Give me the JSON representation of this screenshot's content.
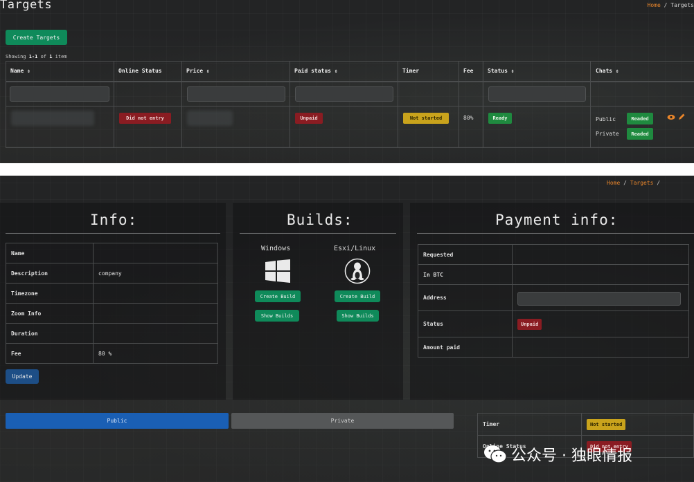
{
  "top": {
    "title": "Targets",
    "breadcrumb": {
      "home": "Home",
      "sep": "/",
      "current": "Targets"
    },
    "create_button": "Create Targets",
    "showing": {
      "prefix": "Showing ",
      "range": "1-1",
      "middle": " of ",
      "count": "1",
      "suffix": " item"
    },
    "columns": [
      "Name",
      "Online Status",
      "Price",
      "Paid status",
      "Timer",
      "Fee",
      "Status",
      "Chats"
    ],
    "sortable": [
      "Name",
      "Price",
      "Paid status",
      "Status",
      "Chats"
    ],
    "row": {
      "online_status": "Did not entry",
      "paid_status": "Unpaid",
      "timer": "Not started",
      "fee": "80%",
      "status": "Ready",
      "chats": [
        {
          "label": "Public",
          "badge": "Readed"
        },
        {
          "label": "Private",
          "badge": "Readed"
        }
      ]
    },
    "sort_icon": "sort-icon",
    "action_icons": [
      "eye-icon",
      "pencil-icon"
    ],
    "colors": {
      "accent": "#e8852a",
      "green": "#0f8a5a",
      "red": "#8a1c22",
      "yellow": "#c9a31c"
    }
  },
  "bottom": {
    "breadcrumb": {
      "home": "Home",
      "sep": "/",
      "current": "Targets",
      "trail": "/"
    },
    "info": {
      "title": "Info:",
      "rows": [
        {
          "key": "Name",
          "value": ""
        },
        {
          "key": "Description",
          "value": "company"
        },
        {
          "key": "Timezone",
          "value": ""
        },
        {
          "key": "Zoom Info",
          "value": ""
        },
        {
          "key": "Duration",
          "value": ""
        },
        {
          "key": "Fee",
          "value": "80 %"
        }
      ],
      "update_button": "Update"
    },
    "builds": {
      "title": "Builds:",
      "windows": {
        "label": "Windows",
        "icon": "windows-icon",
        "create": "Create Build",
        "show": "Show Builds"
      },
      "linux": {
        "label": "Esxi/Linux",
        "icon": "tux-icon",
        "create": "Create Build",
        "show": "Show Builds"
      }
    },
    "payment": {
      "title": "Payment info:",
      "rows": [
        {
          "key": "Requested",
          "value": ""
        },
        {
          "key": "In BTC",
          "value": ""
        },
        {
          "key": "Address",
          "value": ""
        },
        {
          "key": "Status",
          "value": "Unpaid"
        },
        {
          "key": "Amount paid",
          "value": ""
        }
      ]
    },
    "tabs": {
      "public": "Public",
      "private": "Private"
    },
    "status_table": {
      "timer_label": "Timer",
      "timer_value": "Not started",
      "online_label": "Online Status",
      "online_value": "Did not entry"
    }
  },
  "watermark": {
    "icon": "wechat-icon",
    "text": "公众号 · 独眼情报"
  }
}
